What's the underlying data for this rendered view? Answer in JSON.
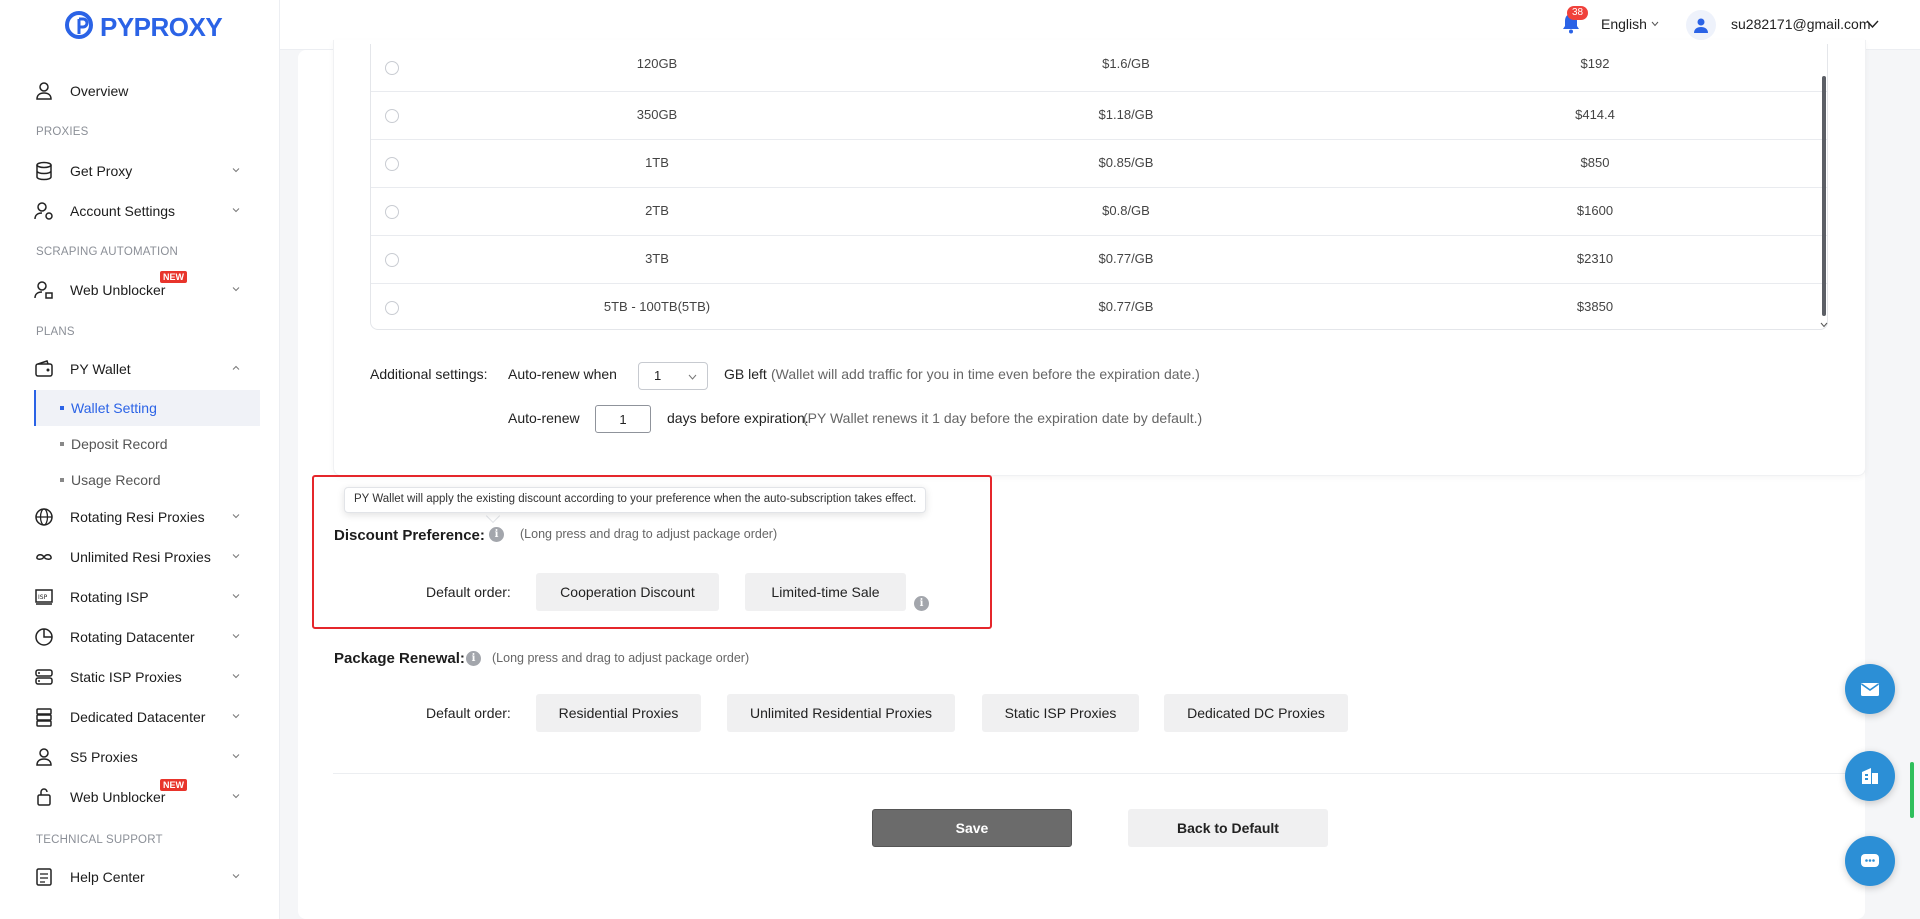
{
  "brand": {
    "name": "PYPROXY"
  },
  "header": {
    "notification_count": "38",
    "language": "English",
    "user_email": "su282171@gmail.com"
  },
  "sidebar": {
    "overview": "Overview",
    "section_proxies": "PROXIES",
    "get_proxy": "Get Proxy",
    "account_settings": "Account Settings",
    "section_scraping": "SCRAPING AUTOMATION",
    "web_unblocker": "Web Unblocker",
    "new_badge": "NEW",
    "section_plans": "PLANS",
    "py_wallet": "PY Wallet",
    "wallet_setting": "Wallet Setting",
    "deposit_record": "Deposit Record",
    "usage_record": "Usage Record",
    "rotating_resi": "Rotating Resi Proxies",
    "unlimited_resi": "Unlimited Resi Proxies",
    "rotating_isp": "Rotating ISP",
    "rotating_dc": "Rotating Datacenter",
    "static_isp": "Static ISP Proxies",
    "dedicated_dc": "Dedicated Datacenter",
    "s5_proxies": "S5 Proxies",
    "web_unblocker_2": "Web Unblocker",
    "section_support": "TECHNICAL SUPPORT",
    "help_center": "Help Center"
  },
  "packages": [
    {
      "size": "120GB",
      "price_per_gb": "$1.6/GB",
      "total": "$192"
    },
    {
      "size": "350GB",
      "price_per_gb": "$1.18/GB",
      "total": "$414.4"
    },
    {
      "size": "1TB",
      "price_per_gb": "$0.85/GB",
      "total": "$850"
    },
    {
      "size": "2TB",
      "price_per_gb": "$0.8/GB",
      "total": "$1600"
    },
    {
      "size": "3TB",
      "price_per_gb": "$0.77/GB",
      "total": "$2310"
    },
    {
      "size": "5TB - 100TB(5TB)",
      "price_per_gb": "$0.77/GB",
      "total": "$3850"
    }
  ],
  "additional": {
    "label": "Additional settings:",
    "auto_renew_when": "Auto-renew when",
    "gb_select_value": "1",
    "gb_left": "GB left",
    "gb_left_note": "(Wallet will add traffic for you in time even before the expiration date.)",
    "auto_renew": "Auto-renew",
    "days_value": "1",
    "days_before": "days before expiration.",
    "days_note": "(PY Wallet renews it 1 day before the expiration date by default.)"
  },
  "discount": {
    "tooltip": "PY Wallet will apply the existing discount according to your preference when the auto-subscription takes effect.",
    "title": "Discount Preference:",
    "hint": "(Long press and drag to adjust package order)",
    "default_order_label": "Default order:",
    "chips": [
      "Cooperation Discount",
      "Limited-time Sale"
    ]
  },
  "renewal": {
    "title": "Package Renewal:",
    "hint": "(Long press and drag to adjust package order)",
    "default_order_label": "Default order:",
    "chips": [
      "Residential Proxies",
      "Unlimited Residential Proxies",
      "Static ISP Proxies",
      "Dedicated DC Proxies"
    ]
  },
  "actions": {
    "save": "Save",
    "back_to_default": "Back to Default"
  },
  "colors": {
    "accent": "#2b63e6",
    "highlight_border": "#e5262b",
    "float_button": "#2c8fd6"
  }
}
